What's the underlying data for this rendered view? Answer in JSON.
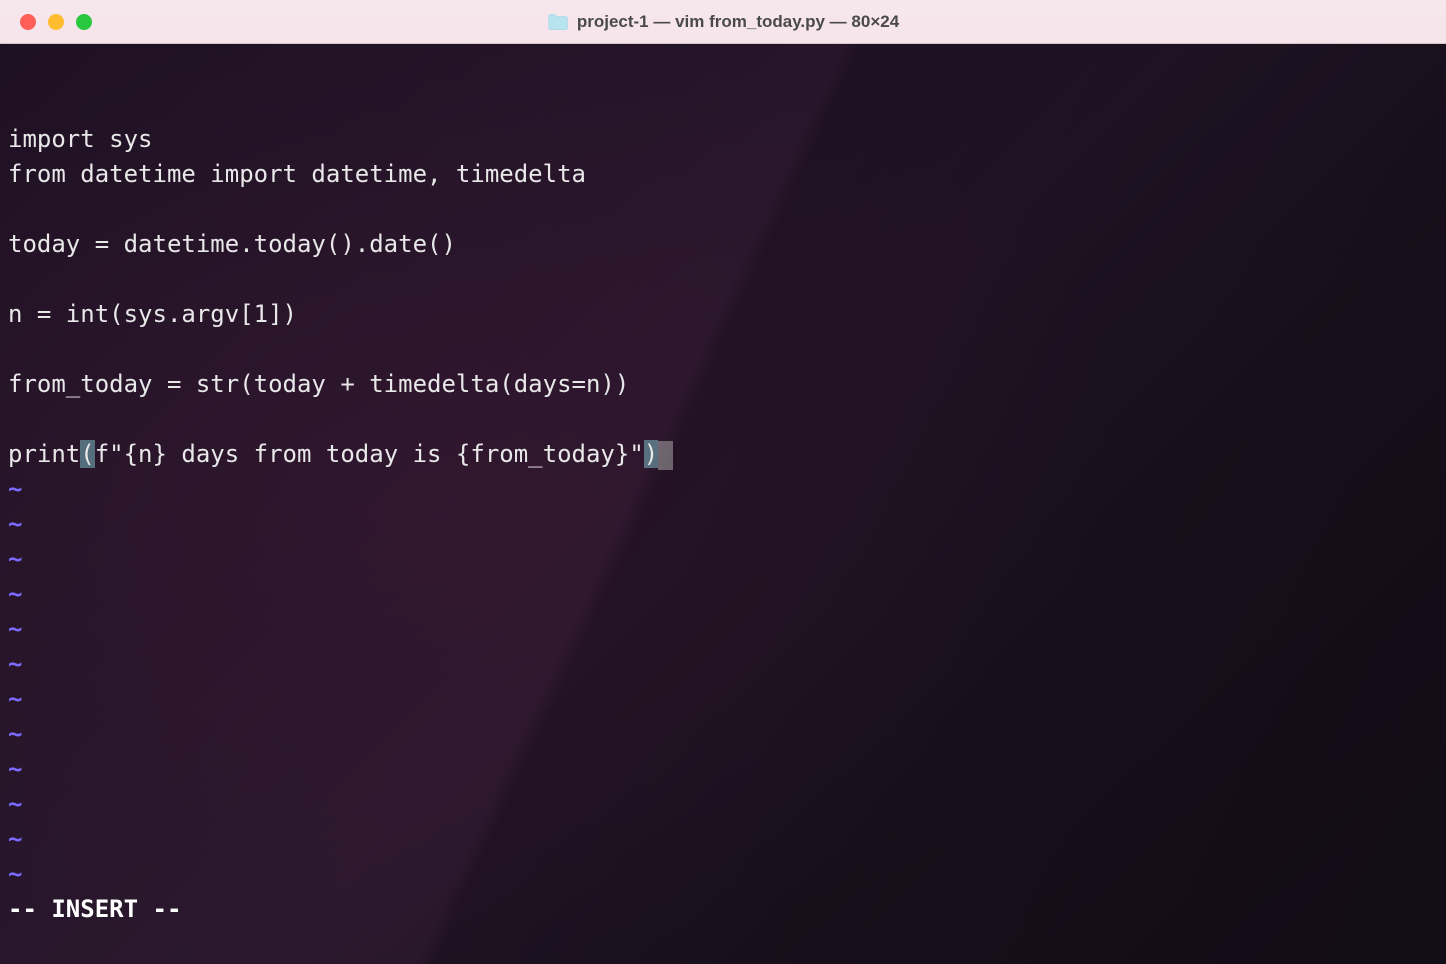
{
  "window": {
    "title": "project-1 — vim from_today.py — 80×24"
  },
  "editor": {
    "lines": [
      "import sys",
      "from datetime import datetime, timedelta",
      "",
      "today = datetime.today().date()",
      "",
      "n = int(sys.argv[1])",
      "",
      "from_today = str(today + timedelta(days=n))",
      ""
    ],
    "print_line": {
      "prefix": "print",
      "open_paren": "(",
      "middle": "f\"{n} days from today is {from_today}\"",
      "close_paren": ")"
    },
    "tilde": "~",
    "tilde_count": 12,
    "status": "-- INSERT --"
  }
}
